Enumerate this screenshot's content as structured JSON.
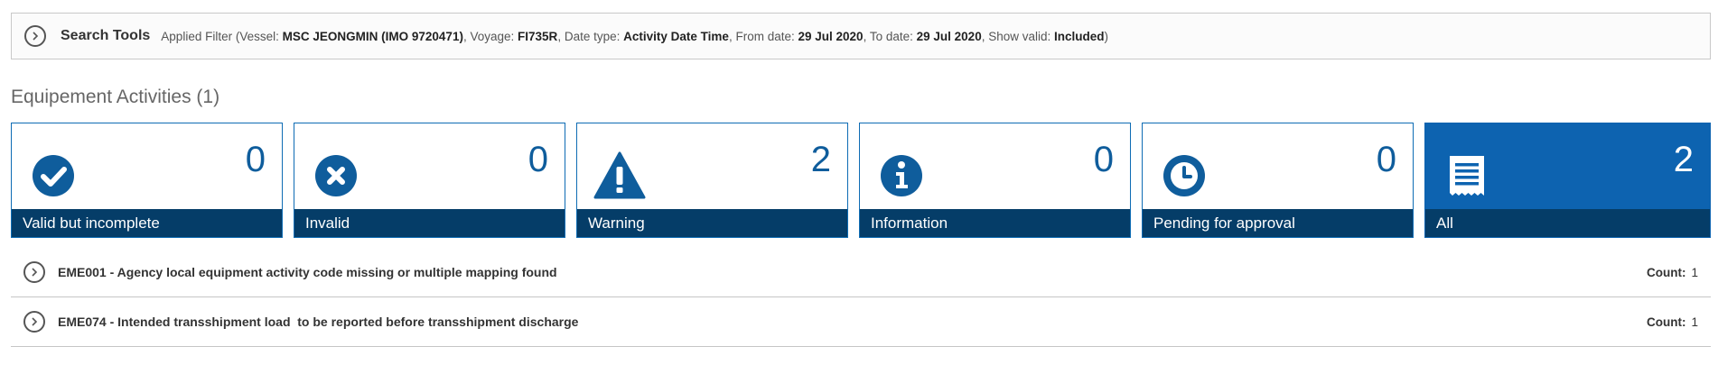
{
  "search": {
    "title": "Search Tools",
    "filter_prefix": "Applied Filter (",
    "vessel_label": "Vessel:",
    "vessel_value": "MSC JEONGMIN (IMO 9720471)",
    "voyage_label": "Voyage:",
    "voyage_value": "FI735R",
    "date_type_label": "Date type:",
    "date_type_value": "Activity Date Time",
    "from_label": "From date:",
    "from_value": "29 Jul 2020",
    "to_label": "To date:",
    "to_value": "29 Jul 2020",
    "valid_label": "Show valid:",
    "valid_value": "Included",
    "filter_suffix": ")"
  },
  "section": {
    "title": "Equipement Activities (1)"
  },
  "cards": [
    {
      "label": "Valid but incomplete",
      "count": "0",
      "icon": "check-circle-icon"
    },
    {
      "label": "Invalid",
      "count": "0",
      "icon": "x-circle-icon"
    },
    {
      "label": "Warning",
      "count": "2",
      "icon": "warning-triangle-icon"
    },
    {
      "label": "Information",
      "count": "0",
      "icon": "info-circle-icon"
    },
    {
      "label": "Pending for approval",
      "count": "0",
      "icon": "clock-icon"
    },
    {
      "label": "All",
      "count": "2",
      "icon": "receipt-list-icon"
    }
  ],
  "rows": [
    {
      "text": "EME001 - Agency local equipment activity code missing or multiple mapping found",
      "count_label": "Count:",
      "count": "1"
    },
    {
      "text": "EME074 - Intended transshipment load  to be reported before transshipment discharge",
      "count_label": "Count:",
      "count": "1"
    }
  ],
  "colors": {
    "primary": "#0d63b0",
    "dark": "#053d68",
    "border": "#0e6cb4"
  }
}
